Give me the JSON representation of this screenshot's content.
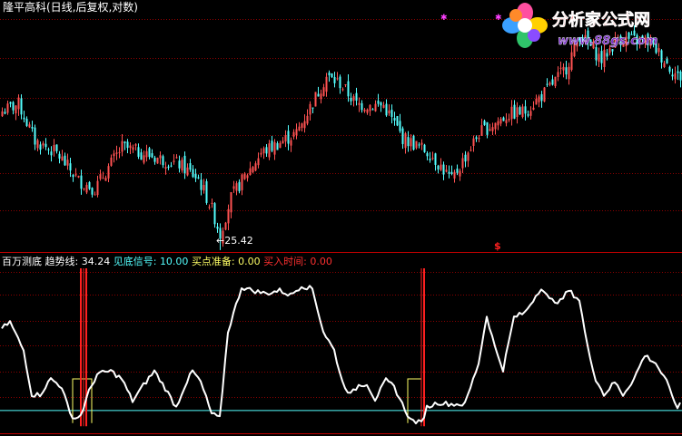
{
  "header": {
    "title": "隆平高科(日线,后复权,对数)"
  },
  "price_panel": {
    "low_marker": "25.42",
    "signal_glyph": "$"
  },
  "indicator_panel": {
    "name": "百万测底",
    "trend_label": "趋势线:",
    "trend_value": "34.24",
    "bottom_label": "见底信号:",
    "bottom_value": "10.00",
    "ready_label": "买点准备:",
    "ready_value": "0.00",
    "buy_label": "买入时间:",
    "buy_value": "0.00"
  },
  "watermark": {
    "brand": "分析家公式网",
    "url": "www.88gs.com"
  },
  "colors": {
    "up": "#ff5252",
    "down": "#54ffff",
    "trend": "#ffffff",
    "bottom_signal": "#54ffff",
    "ready": "#ffff66",
    "buy": "#ff2020",
    "grid": "#8b0000",
    "header_text": "#ffffff",
    "brand": "#ff2a2a",
    "url_text": "#7a2fc8"
  },
  "chart_data": [
    {
      "type": "candlestick",
      "scale": "log",
      "x": "bar index",
      "ylim": [
        24.5,
        40.5
      ],
      "low_label_bar": 80,
      "signal_bar": 183,
      "markers_bars": [
        162,
        182
      ],
      "anchors": [
        [
          0,
          33.0
        ],
        [
          6,
          33.5
        ],
        [
          12,
          31.0
        ],
        [
          20,
          30.2
        ],
        [
          28,
          28.5
        ],
        [
          34,
          28.0
        ],
        [
          44,
          30.6
        ],
        [
          55,
          30.0
        ],
        [
          65,
          29.5
        ],
        [
          72,
          28.6
        ],
        [
          77,
          26.8
        ],
        [
          80,
          25.42
        ],
        [
          84,
          27.5
        ],
        [
          95,
          30.2
        ],
        [
          108,
          31.5
        ],
        [
          115,
          34.0
        ],
        [
          119,
          35.5
        ],
        [
          124,
          35.0
        ],
        [
          130,
          33.5
        ],
        [
          140,
          33.4
        ],
        [
          147,
          31.2
        ],
        [
          157,
          30.2
        ],
        [
          165,
          28.5
        ],
        [
          175,
          31.5
        ],
        [
          186,
          32.8
        ],
        [
          192,
          33.0
        ],
        [
          200,
          34.5
        ],
        [
          207,
          36.2
        ],
        [
          212,
          38.8
        ],
        [
          220,
          36.8
        ],
        [
          226,
          38.5
        ],
        [
          238,
          38.2
        ],
        [
          244,
          36.5
        ],
        [
          248,
          35.5
        ]
      ]
    },
    {
      "type": "line",
      "series": [
        {
          "name": "趋势线",
          "anchors": [
            [
              0,
              62
            ],
            [
              3,
              66
            ],
            [
              8,
              48
            ],
            [
              11,
              20
            ],
            [
              14,
              20
            ],
            [
              18,
              30
            ],
            [
              22,
              25
            ],
            [
              25,
              8
            ],
            [
              27,
              5
            ],
            [
              29,
              7
            ],
            [
              32,
              22
            ],
            [
              35,
              33
            ],
            [
              40,
              35
            ],
            [
              44,
              30
            ],
            [
              48,
              16
            ],
            [
              52,
              26
            ],
            [
              56,
              35
            ],
            [
              60,
              24
            ],
            [
              64,
              12
            ],
            [
              67,
              25
            ],
            [
              70,
              35
            ],
            [
              73,
              28
            ],
            [
              77,
              8
            ],
            [
              80,
              5
            ],
            [
              83,
              60
            ],
            [
              88,
              88
            ],
            [
              92,
              86
            ],
            [
              97,
              84
            ],
            [
              102,
              86
            ],
            [
              106,
              83
            ],
            [
              110,
              89
            ],
            [
              114,
              87
            ],
            [
              118,
              60
            ],
            [
              122,
              48
            ],
            [
              125,
              28
            ],
            [
              128,
              20
            ],
            [
              131,
              26
            ],
            [
              134,
              27
            ],
            [
              137,
              17
            ],
            [
              141,
              29
            ],
            [
              144,
              25
            ],
            [
              147,
              14
            ],
            [
              150,
              4
            ],
            [
              154,
              2
            ],
            [
              156,
              12
            ],
            [
              160,
              15
            ],
            [
              165,
              14
            ],
            [
              170,
              14
            ],
            [
              175,
              40
            ],
            [
              178,
              70
            ],
            [
              181,
              50
            ],
            [
              184,
              36
            ],
            [
              188,
              69
            ],
            [
              192,
              72
            ],
            [
              195,
              80
            ],
            [
              198,
              88
            ],
            [
              201,
              80
            ],
            [
              205,
              79
            ],
            [
              208,
              86
            ],
            [
              212,
              80
            ],
            [
              215,
              50
            ],
            [
              218,
              30
            ],
            [
              221,
              20
            ],
            [
              225,
              28
            ],
            [
              228,
              20
            ],
            [
              232,
              30
            ],
            [
              236,
              45
            ],
            [
              240,
              40
            ],
            [
              244,
              28
            ],
            [
              247,
              16
            ],
            [
              248,
              10
            ],
            [
              250,
              20
            ]
          ]
        },
        {
          "name": "见底信号",
          "value": 10
        },
        {
          "name": "买点准备",
          "segments": [
            [
              26,
              33
            ],
            [
              149,
              154
            ]
          ]
        },
        {
          "name": "买入时间",
          "bars": [
            29,
            30,
            31,
            154,
            155
          ]
        }
      ],
      "ylim": [
        -1,
        100
      ]
    }
  ]
}
